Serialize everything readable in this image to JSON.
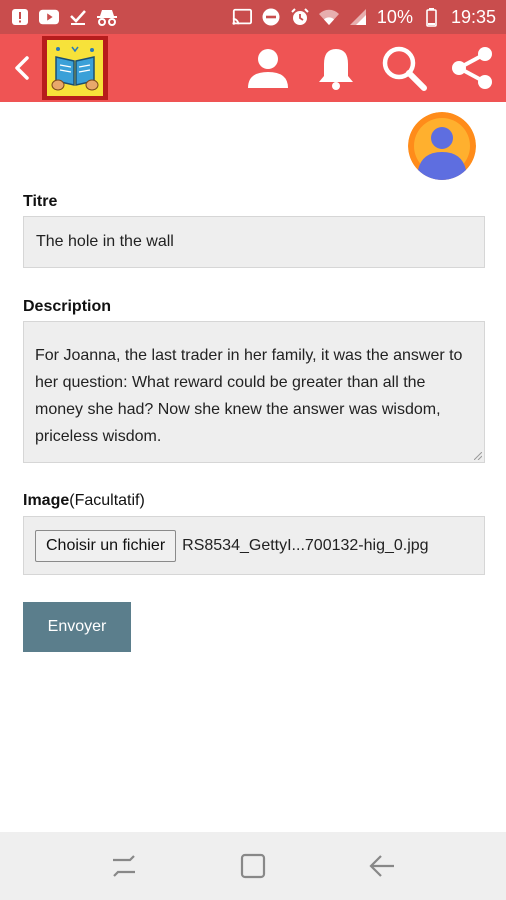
{
  "status_bar": {
    "battery": "10%",
    "time": "19:35",
    "left_icons": [
      "alert-icon",
      "youtube-icon",
      "download-done-icon",
      "incognito-icon"
    ],
    "right_icons": [
      "cast-icon",
      "do-not-disturb-icon",
      "alarm-icon",
      "wifi-icon",
      "signal-icon",
      "battery-icon"
    ]
  },
  "app_bar": {
    "icons": [
      "back-icon",
      "app-logo",
      "user-icon",
      "bell-icon",
      "search-icon",
      "share-icon"
    ]
  },
  "form": {
    "title_label": "Titre",
    "title_value": "The hole in the wall",
    "description_label": "Description",
    "description_value": "For Joanna, the last trader in her family, it was the answer to her question: What reward could be greater than all the money she had? Now she knew the answer was wisdom, priceless wisdom.",
    "image_label": "Image",
    "image_optional": "(Facultatif)",
    "choose_file_label": "Choisir un fichier",
    "file_name": "RS8534_GettyI...700132-hig_0.jpg",
    "submit_label": "Envoyer"
  },
  "nav_bar": {
    "icons": [
      "recents-icon",
      "home-icon",
      "back-arrow-icon"
    ]
  },
  "colors": {
    "status_bar": "#c94d4d",
    "app_bar": "#ef5454",
    "submit": "#5b7e8c",
    "avatar_ring": "#ff8c1a",
    "avatar_person": "#5e6ee0"
  }
}
